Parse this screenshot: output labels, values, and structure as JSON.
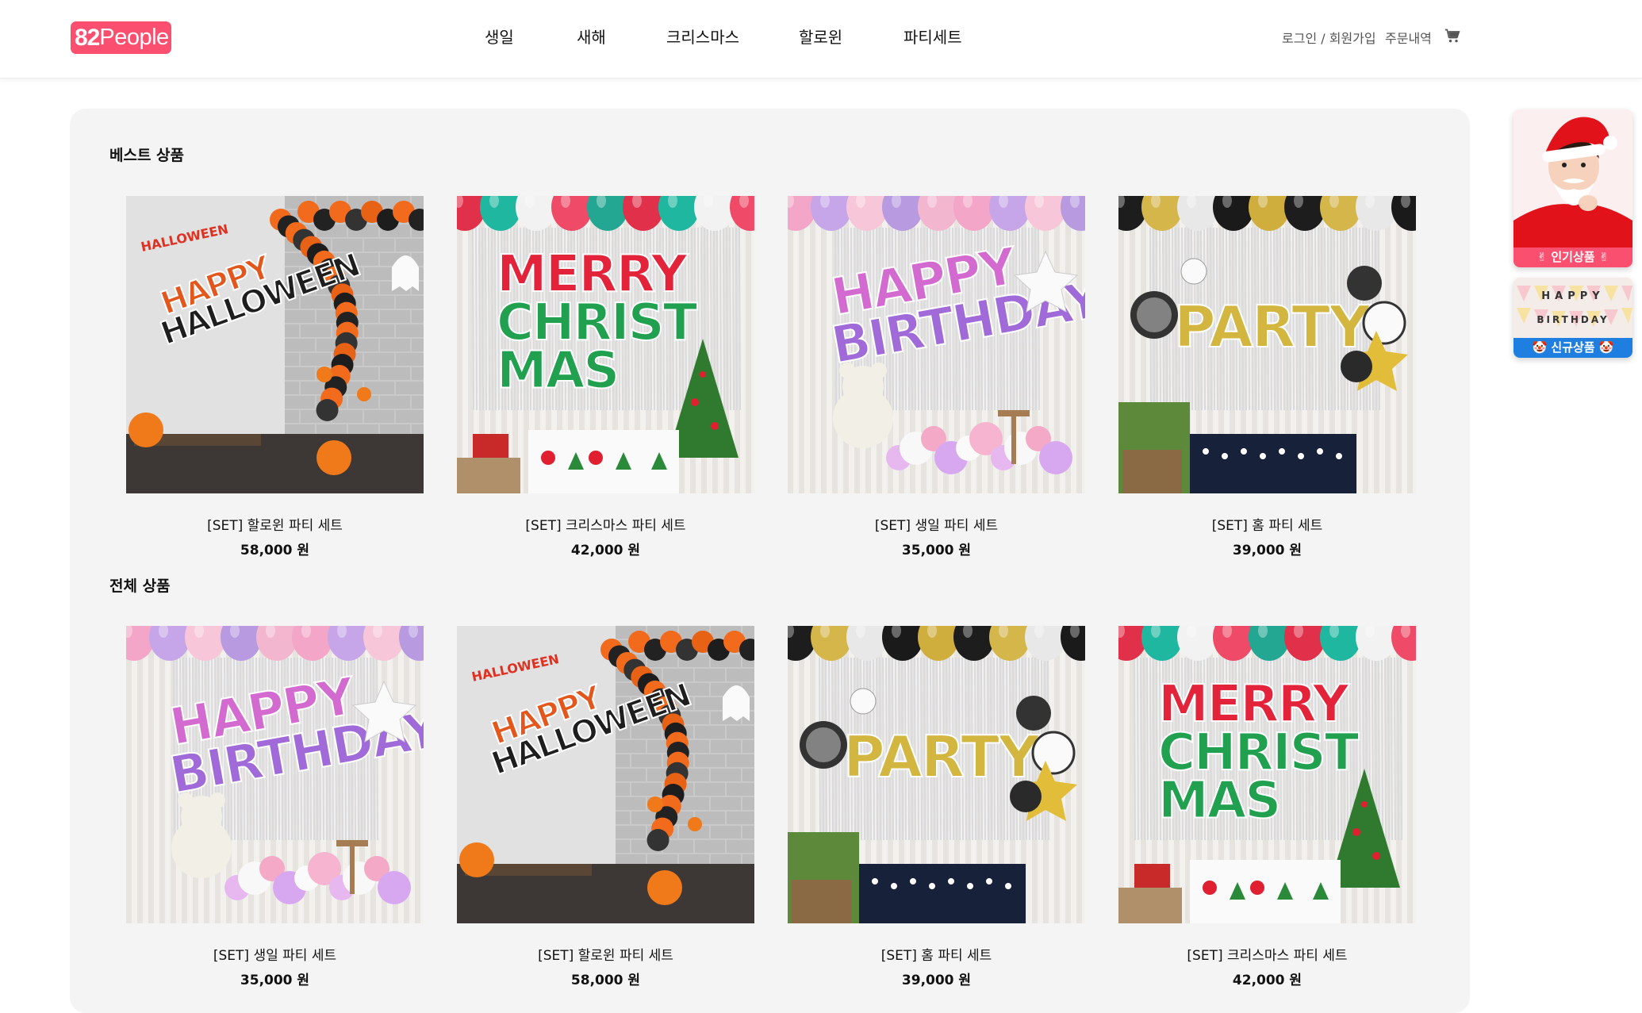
{
  "header": {
    "logo_num": "82",
    "logo_word": "People",
    "nav": [
      "생일",
      "새해",
      "크리스마스",
      "할로윈",
      "파티세트"
    ],
    "login": "로그인 / 회원가입",
    "orders": "주문내역",
    "cart_icon": "cart-icon"
  },
  "sections": {
    "best_title": "베스트 상품",
    "all_title": "전체 상품"
  },
  "best_products": [
    {
      "name": "[SET] 할로윈 파티 세트",
      "price": "58,000 원",
      "theme": "halloween"
    },
    {
      "name": "[SET] 크리스마스 파티 세트",
      "price": "42,000 원",
      "theme": "christmas"
    },
    {
      "name": "[SET] 생일 파티 세트",
      "price": "35,000 원",
      "theme": "birthday"
    },
    {
      "name": "[SET] 홈 파티 세트",
      "price": "39,000 원",
      "theme": "party"
    }
  ],
  "all_products": [
    {
      "name": "[SET] 생일 파티 세트",
      "price": "35,000 원",
      "theme": "birthday"
    },
    {
      "name": "[SET] 할로윈 파티 세트",
      "price": "58,000 원",
      "theme": "halloween"
    },
    {
      "name": "[SET] 홈 파티 세트",
      "price": "39,000 원",
      "theme": "party"
    },
    {
      "name": "[SET] 크리스마스 파티 세트",
      "price": "42,000 원",
      "theme": "christmas"
    }
  ],
  "banner_words": {
    "halloween": [
      "HALLOWEEN",
      "HAPPY",
      "HALLOWEEN"
    ],
    "christmas": [
      "MERRY",
      "CHRIST",
      "MAS"
    ],
    "birthday": [
      "HAPPY",
      "BIRTHDAY"
    ],
    "party": [
      "PARTY"
    ]
  },
  "side": {
    "popular_label": "✌ 인기상품 ✌",
    "new_label": "🤡 신규상품 🤡",
    "new_banner_top": "HAPPY",
    "new_banner_bottom": "BIRTHDAY"
  },
  "colors": {
    "brand": "#fb4f6f",
    "popular": "#fb4f6f",
    "new": "#1f7fe0",
    "panel": "#f4f4f4"
  }
}
